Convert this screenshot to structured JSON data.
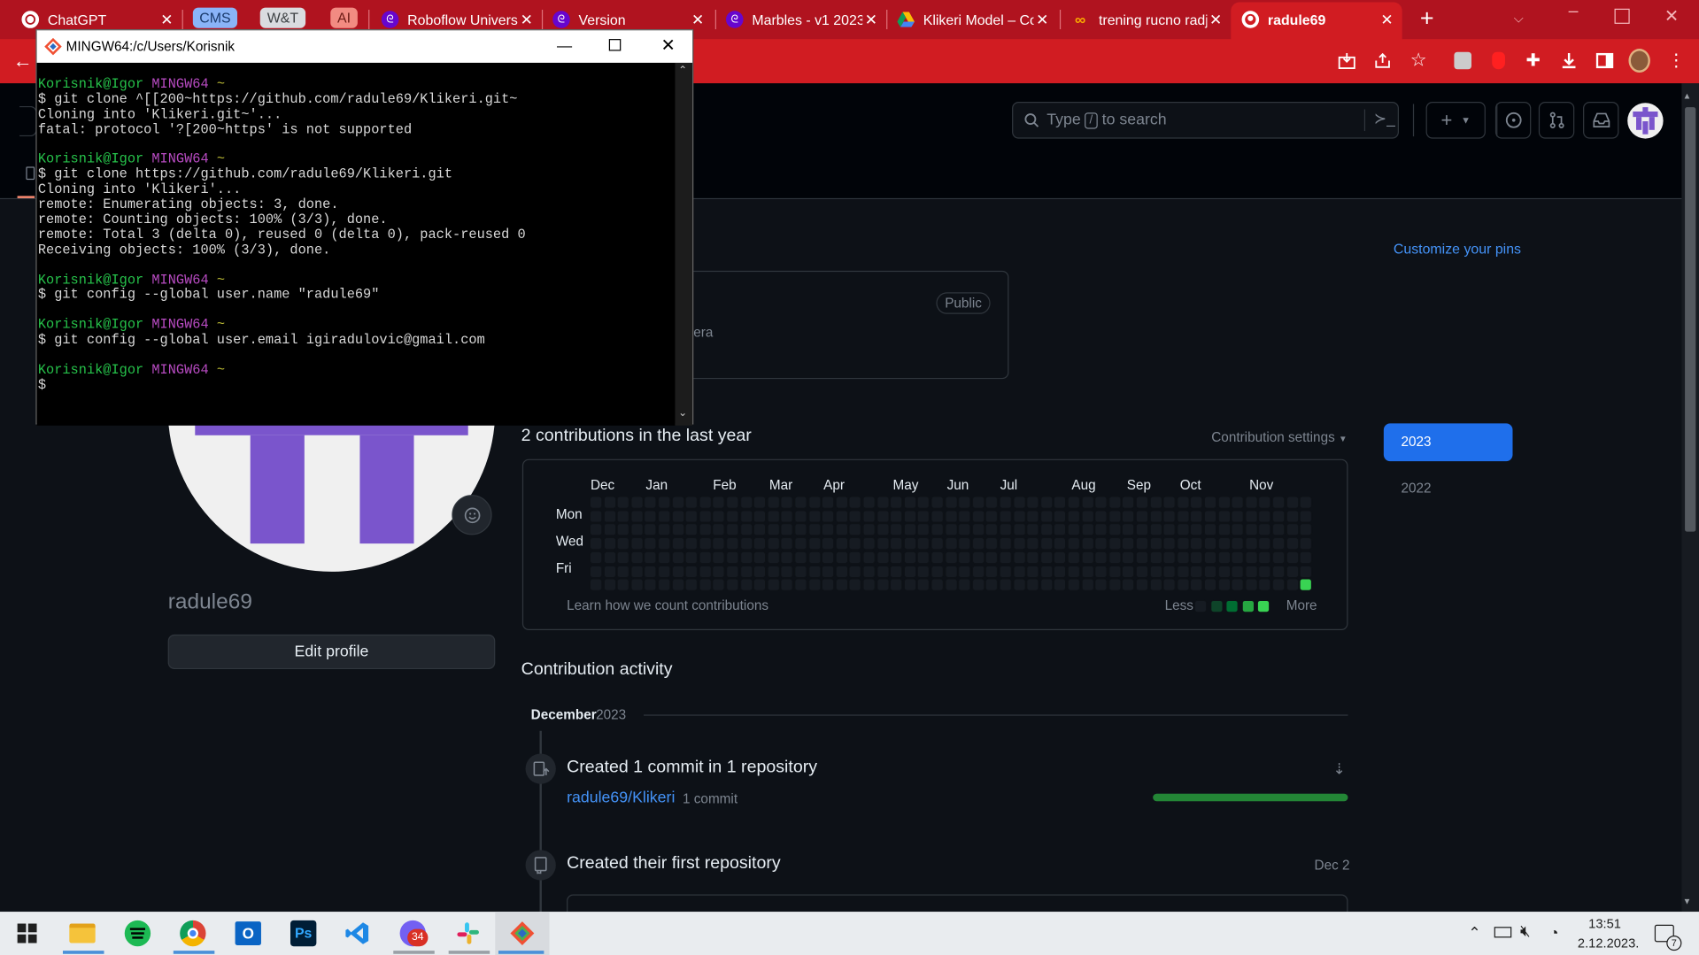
{
  "browser": {
    "tabs": [
      {
        "title": "ChatGPT",
        "icon": "chatgpt-icon"
      },
      {
        "group": "CMS",
        "color": "#8ab4f8"
      },
      {
        "group": "W&T",
        "color": "#dadce0"
      },
      {
        "group": "AI",
        "color": "#f28b82"
      },
      {
        "title": "Roboflow Universe",
        "icon": "roboflow-icon"
      },
      {
        "title": "Version",
        "icon": "roboflow-icon"
      },
      {
        "title": "Marbles - v1 2023",
        "icon": "roboflow-icon"
      },
      {
        "title": "Klikeri Model – Colab",
        "icon": "google-drive-icon"
      },
      {
        "title": "trening rucno radjeno",
        "icon": "colab-icon"
      },
      {
        "title": "radule69",
        "icon": "github-icon",
        "active": true
      }
    ],
    "new_tab": "+"
  },
  "github": {
    "search_placeholder_pre": "Type",
    "search_key": "/",
    "search_placeholder_post": "to search",
    "customize_pins": "Customize your pins",
    "pinned_repo_badge": "Public",
    "pinned_repo_desc_fragment": "era",
    "username": "radule69",
    "edit_profile": "Edit profile",
    "contributions_heading": "2 contributions in the last year",
    "contribution_settings": "Contribution settings",
    "months": [
      "Dec",
      "Jan",
      "Feb",
      "Mar",
      "Apr",
      "May",
      "Jun",
      "Jul",
      "Aug",
      "Sep",
      "Oct",
      "Nov"
    ],
    "days": [
      "Mon",
      "Wed",
      "Fri"
    ],
    "learn_link": "Learn how we count contributions",
    "legend_less": "Less",
    "legend_more": "More",
    "legend_colors": [
      "#161b22",
      "#0e4429",
      "#006d32",
      "#26a641",
      "#39d353"
    ],
    "years": [
      "2023",
      "2022"
    ],
    "selected_year": "2023",
    "activity_heading": "Contribution activity",
    "activity_month": "December",
    "activity_year": "2023",
    "activity": [
      {
        "title": "Created 1 commit in 1 repository",
        "repo": "radule69/Klikeri",
        "count": "1 commit",
        "progress": 1.0
      },
      {
        "title": "Created their first repository",
        "date": "Dec 2"
      }
    ]
  },
  "terminal": {
    "title": "MINGW64:/c/Users/Korisnik",
    "lines": [
      {
        "prompt": true
      },
      {
        "text": "$ git clone ^[[200~https://github.com/radule69/Klikeri.git~"
      },
      {
        "text": "Cloning into 'Klikeri.git~'..."
      },
      {
        "text": "fatal: protocol '?[200~https' is not supported"
      },
      {
        "blank": true
      },
      {
        "prompt": true
      },
      {
        "text": "$ git clone https://github.com/radule69/Klikeri.git"
      },
      {
        "text": "Cloning into 'Klikeri'..."
      },
      {
        "text": "remote: Enumerating objects: 3, done."
      },
      {
        "text": "remote: Counting objects: 100% (3/3), done."
      },
      {
        "text": "remote: Total 3 (delta 0), reused 0 (delta 0), pack-reused 0"
      },
      {
        "text": "Receiving objects: 100% (3/3), done."
      },
      {
        "blank": true
      },
      {
        "prompt": true
      },
      {
        "text": "$ git config --global user.name \"radule69\""
      },
      {
        "blank": true
      },
      {
        "prompt": true
      },
      {
        "text": "$ git config --global user.email igiradulovic@gmail.com"
      },
      {
        "blank": true
      },
      {
        "prompt": true
      },
      {
        "text": "$"
      }
    ],
    "prompt_user": "Korisnik@Igor",
    "prompt_host": "MINGW64",
    "prompt_dir": "~"
  },
  "taskbar": {
    "apps": [
      "windows-start-icon",
      "file-explorer-icon",
      "spotify-icon",
      "chrome-icon",
      "outlook-icon",
      "photoshop-icon",
      "vscode-icon",
      "viber-icon",
      "slack-icon",
      "git-bash-icon"
    ],
    "viber_badge": "34",
    "time": "13:51",
    "date": "2.12.2023.",
    "notification_count": "7"
  }
}
